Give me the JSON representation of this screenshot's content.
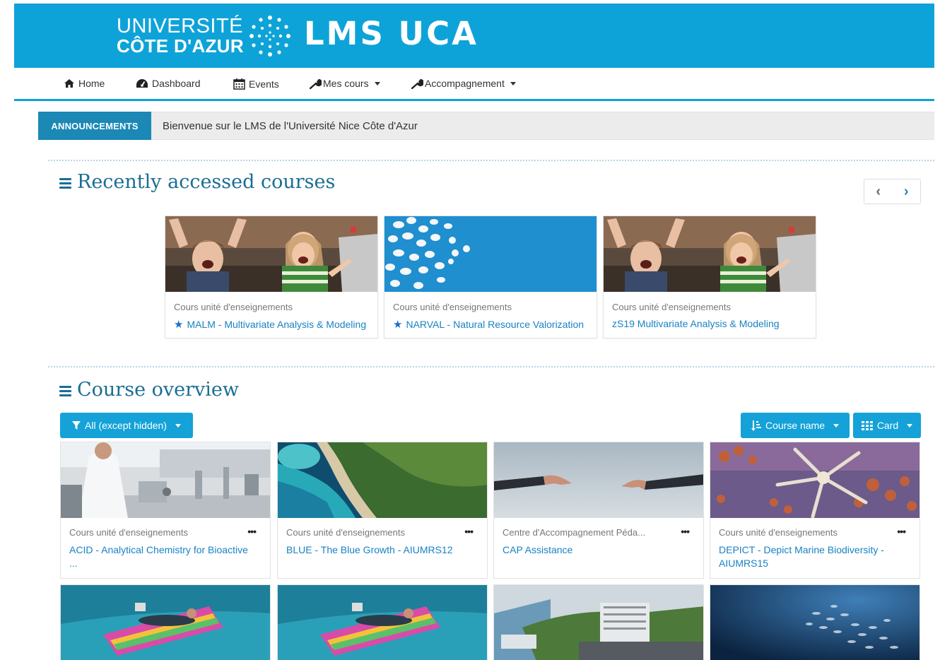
{
  "header": {
    "uni_line1": "UNIVERSITÉ",
    "uni_line2": "CÔTE D'AZUR",
    "site_title": "LMS UCA",
    "banner_color": "#0ea3d8"
  },
  "nav": {
    "items": [
      {
        "label": "Home",
        "icon": "home-icon"
      },
      {
        "label": "Dashboard",
        "icon": "dashboard-icon"
      },
      {
        "label": "Events",
        "icon": "calendar-icon"
      },
      {
        "label": "Mes cours",
        "icon": "wrench-icon",
        "dropdown": true
      },
      {
        "label": "Accompagnement",
        "icon": "wrench-icon",
        "dropdown": true
      }
    ]
  },
  "announcements": {
    "label": "ANNOUNCEMENTS",
    "text": "Bienvenue sur le LMS de l'Université Nice Côte d'Azur"
  },
  "recent": {
    "title": "Recently accessed courses",
    "prev_label": "‹",
    "next_label": "›",
    "cards": [
      {
        "category": "Cours unité d'enseignements",
        "name": "MALM - Multivariate Analysis & Modeling",
        "starred": true,
        "image": "kids-laptop"
      },
      {
        "category": "Cours unité d'enseignements",
        "name": "NARVAL - Natural Resource Valorization",
        "starred": true,
        "image": "pills-blue"
      },
      {
        "category": "Cours unité d'enseignements",
        "name": "zS19 Multivariate Analysis & Modeling",
        "starred": false,
        "image": "kids-laptop"
      }
    ]
  },
  "overview": {
    "title": "Course overview",
    "filter_label": "All (except hidden)",
    "sort_label": "Course name",
    "view_label": "Card",
    "more_label": "•••",
    "cards": [
      {
        "category": "Cours unité d'enseignements",
        "name": "ACID - Analytical Chemistry for Bioactive ...",
        "image": "lab"
      },
      {
        "category": "Cours unité d'enseignements",
        "name": "BLUE - The Blue Growth - AIUMRS12",
        "image": "coast"
      },
      {
        "category": "Centre d'Accompagnement Péda...",
        "name": "CAP Assistance",
        "image": "hands-sky"
      },
      {
        "category": "Cours unité d'enseignements",
        "name": "DEPICT - Depict Marine Biodiversity - AIUMRS15",
        "image": "coral"
      }
    ],
    "bottom_cards": [
      {
        "image": "float-sea"
      },
      {
        "image": "float-sea"
      },
      {
        "image": "city-coast"
      },
      {
        "image": "fish-school"
      }
    ]
  }
}
